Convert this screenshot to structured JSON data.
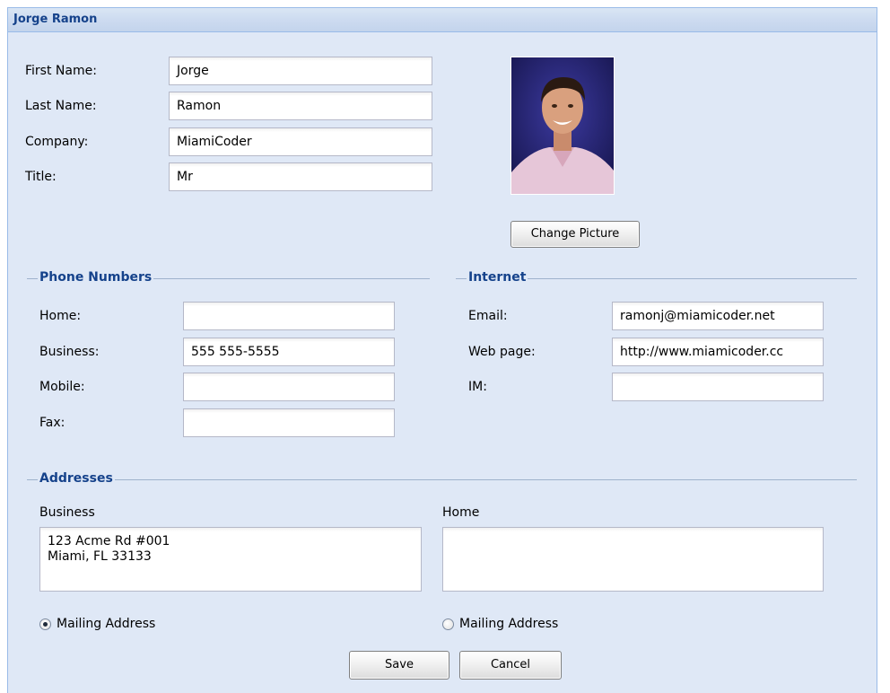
{
  "panel": {
    "title": "Jorge Ramon"
  },
  "contact": {
    "first_name": {
      "label": "First Name:",
      "value": "Jorge"
    },
    "last_name": {
      "label": "Last Name:",
      "value": "Ramon"
    },
    "company": {
      "label": "Company:",
      "value": "MiamiCoder"
    },
    "title": {
      "label": "Title:",
      "value": "Mr"
    },
    "change_picture_label": "Change Picture"
  },
  "phone": {
    "legend": "Phone Numbers",
    "home": {
      "label": "Home:",
      "value": ""
    },
    "business": {
      "label": "Business:",
      "value": "555 555-5555"
    },
    "mobile": {
      "label": "Mobile:",
      "value": ""
    },
    "fax": {
      "label": "Fax:",
      "value": ""
    }
  },
  "internet": {
    "legend": "Internet",
    "email": {
      "label": "Email:",
      "value": "ramonj@miamicoder.net"
    },
    "web": {
      "label": "Web page:",
      "value": "http://www.miamicoder.cc"
    },
    "im": {
      "label": "IM:",
      "value": ""
    }
  },
  "addresses": {
    "legend": "Addresses",
    "business": {
      "label": "Business",
      "value": "123 Acme Rd #001\nMiami, FL 33133",
      "mailing_label": "Mailing Address",
      "mailing_selected": true
    },
    "home": {
      "label": "Home",
      "value": "",
      "mailing_label": "Mailing Address",
      "mailing_selected": false
    }
  },
  "buttons": {
    "save_label": "Save",
    "cancel_label": "Cancel"
  },
  "colors": {
    "panel_bg": "#dfe8f6",
    "header_text": "#15428b",
    "border": "#99bbe8"
  }
}
